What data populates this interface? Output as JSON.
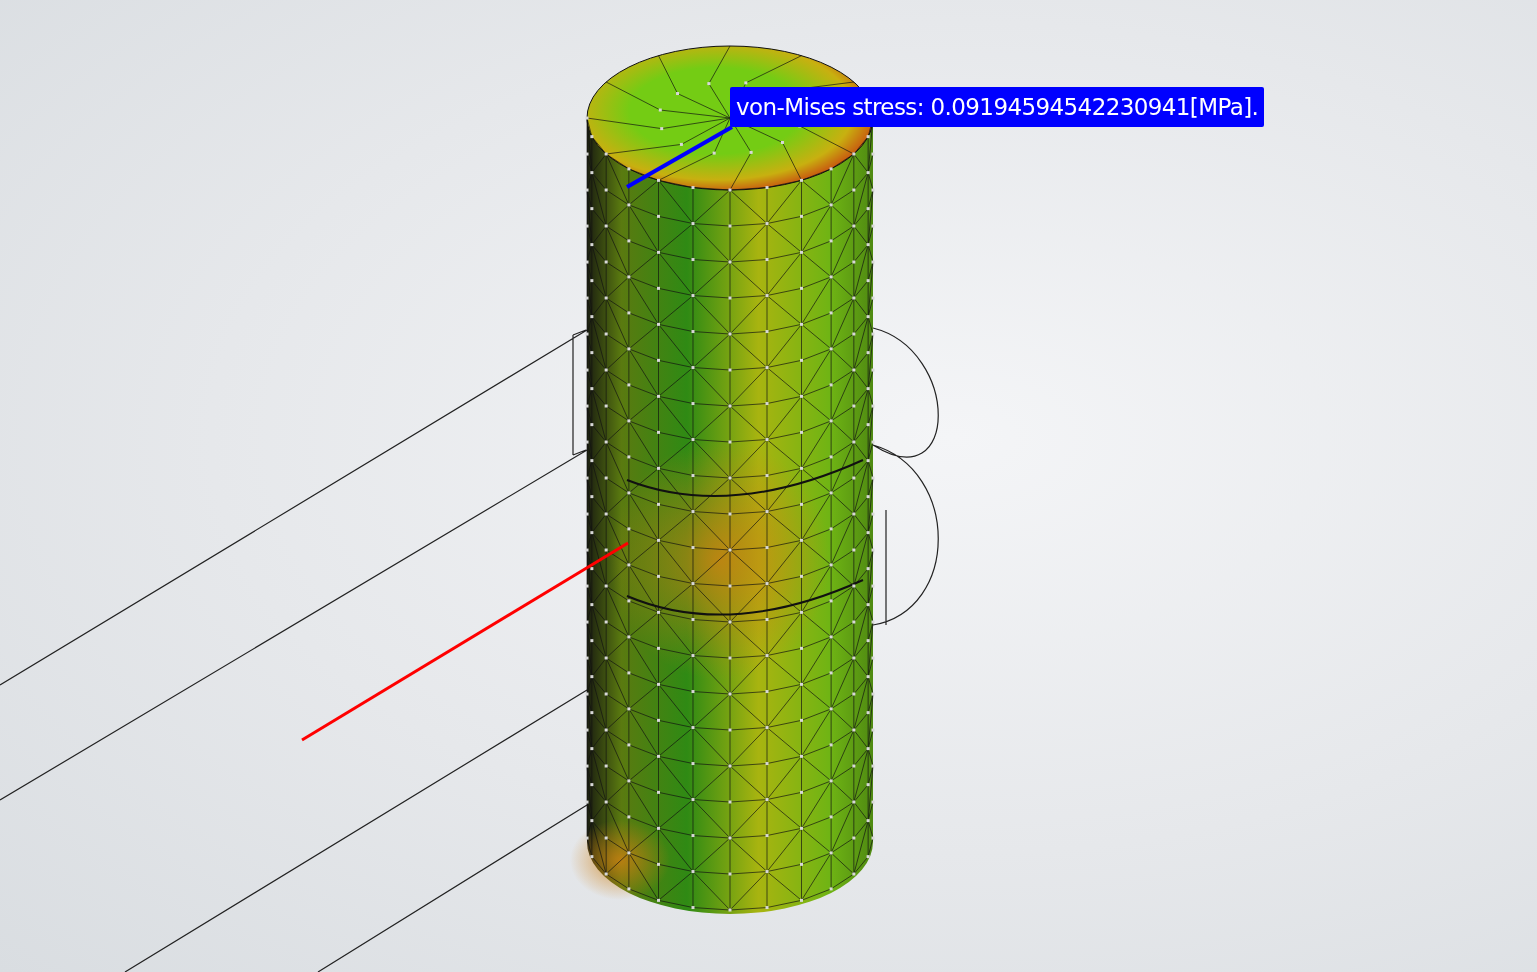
{
  "annotation": {
    "text": "von-Mises stress: 0.09194594542230941[MPa]."
  }
}
